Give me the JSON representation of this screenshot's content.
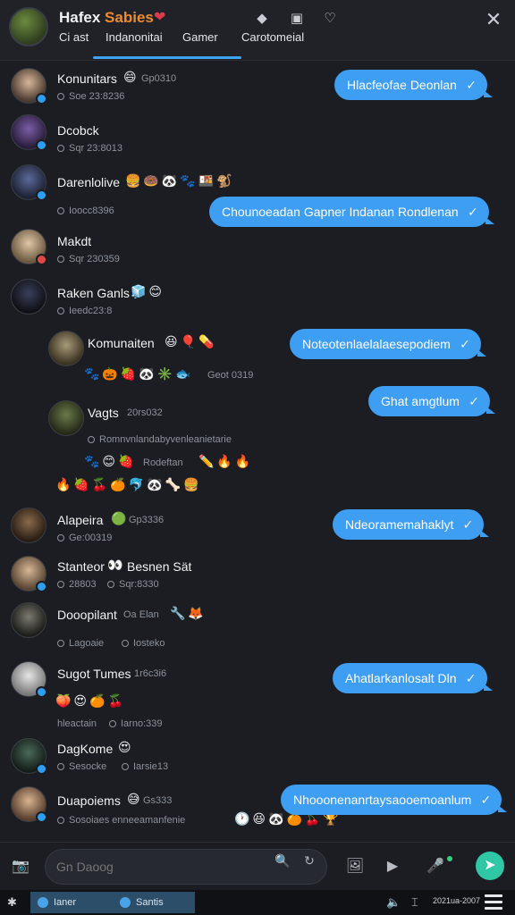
{
  "header": {
    "title_main": "Hafex",
    "title_accent": "Sabies",
    "tabs": [
      "Ci ast",
      "Indanonitai",
      "Gamer",
      "Carotomeial"
    ],
    "icons": [
      "heart-icon",
      "diamond-icon",
      "image-icon",
      "heart-outline-icon",
      "close-icon"
    ],
    "accent_color": "#3da3f2"
  },
  "messages": [
    {
      "name": "Konunitars",
      "meta": "Soe 23:8236",
      "name_extra": "Gp0310",
      "bubble": "Hlacfeofae Deonlan"
    },
    {
      "name": "Dcobck",
      "meta": "Sqr 23:8013"
    },
    {
      "name": "Darenlolive",
      "meta": "Ioocc8396",
      "bubble": "Chounoeadan Gapner Indanan Rondlenan"
    },
    {
      "name": "Makdt",
      "meta": "Sqr 230359"
    },
    {
      "name": "Raken Ganls",
      "meta": "Ieedc23:8"
    },
    {
      "name": "Komunaiten",
      "meta": "Geot 0319",
      "bubble": "Noteotenlaelalaesepodiem"
    },
    {
      "name": "Vagts",
      "name_extra": "20rs032",
      "meta": "Romnvnlandabyvenleanietarie",
      "meta2": "Rodeftan",
      "bubble": "Ghat amgtlum"
    },
    {
      "name": "Alapeira",
      "name_extra": "Gp3336",
      "meta": "Ge:00319",
      "bubble": "Ndeoramemahaklyt"
    },
    {
      "name": "Stanteor",
      "name_extra": "Besnen Sät",
      "meta": "28803",
      "meta2": "Sqr:8330"
    },
    {
      "name": "Dooopilant",
      "name_extra": "Oa Elan",
      "meta": "Lagoaie",
      "meta2": "Iosteko"
    },
    {
      "name": "Sugot Tumes",
      "name_extra": "1r6c3i6",
      "meta": "hleactain",
      "meta2": "Iarno:339",
      "bubble": "Ahatlarkanlosalt Dln"
    },
    {
      "name": "DagKome",
      "meta": "Sesocke",
      "meta2": "Iarsie13"
    },
    {
      "name": "Duapoiems",
      "name_extra": "Gs333",
      "meta": "Sosoiaes enneeamanfenie",
      "bubble": "Nhooonenanrtaysaooemoanlum"
    }
  ],
  "composer": {
    "placeholder": "Gn Daoog",
    "icons": [
      "camera-icon",
      "search-icon",
      "refresh-icon",
      "gallery-icon",
      "video-icon",
      "voice-icon",
      "send-icon"
    ]
  },
  "taskbar": {
    "tasks": [
      "Ianer",
      "Santis"
    ],
    "clock": "2021ua-2007"
  }
}
